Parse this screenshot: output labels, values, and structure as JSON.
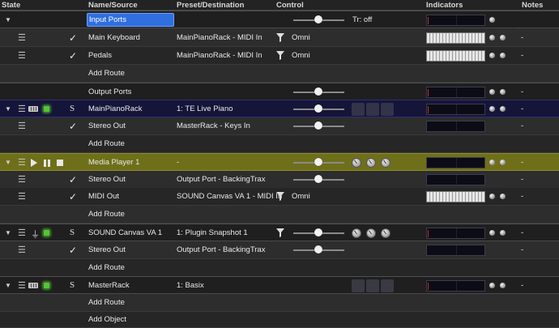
{
  "header": {
    "state": "State",
    "name": "Name/Source",
    "preset": "Preset/Destination",
    "control": "Control",
    "indicators": "Indicators",
    "notes": "Notes"
  },
  "rows": {
    "input_ports": {
      "name": "Input Ports",
      "control_text": "Tr: off"
    },
    "main_keyboard": {
      "name": "Main Keyboard",
      "preset": "MainPianoRack - MIDI In",
      "channel": "Omni",
      "notes": "-"
    },
    "pedals": {
      "name": "Pedals",
      "preset": "MainPianoRack - MIDI In",
      "channel": "Omni",
      "notes": "-"
    },
    "add_route_1": {
      "name": "Add Route"
    },
    "output_ports": {
      "name": "Output Ports",
      "notes": "-"
    },
    "main_piano_rack": {
      "name": "MainPianoRack",
      "preset": "1: TE Live Piano",
      "notes": "-"
    },
    "stereo_out_1": {
      "name": "Stereo Out",
      "preset": "MasterRack - Keys In",
      "notes": "-"
    },
    "add_route_2": {
      "name": "Add Route"
    },
    "media_player": {
      "name": "Media Player 1",
      "preset": "-",
      "notes": "-"
    },
    "stereo_out_2": {
      "name": "Stereo Out",
      "preset": "Output Port - BackingTrax",
      "notes": "-"
    },
    "midi_out": {
      "name": "MIDI Out",
      "preset": "SOUND Canvas VA 1 - MIDI In",
      "channel": "Omni",
      "notes": "-"
    },
    "add_route_3": {
      "name": "Add Route"
    },
    "sound_canvas": {
      "name": "SOUND Canvas VA 1",
      "preset": "1: Plugin Snapshot 1",
      "notes": "-"
    },
    "stereo_out_3": {
      "name": "Stereo Out",
      "preset": "Output Port - BackingTrax",
      "notes": "-"
    },
    "add_route_4": {
      "name": "Add Route"
    },
    "master_rack": {
      "name": "MasterRack",
      "preset": "1: Basix",
      "notes": "-"
    },
    "add_route_5": {
      "name": "Add Route"
    },
    "add_object": {
      "name": "Add Object"
    }
  },
  "icons": {
    "s_letter": "S",
    "checkmark": "✓",
    "menu": "☰",
    "expand": "▼"
  },
  "colors": {
    "selection_blue": "#2f6fe0",
    "rack_row": "#15153a",
    "media_row": "#6f6f1a",
    "status_green": "#58c23a"
  }
}
